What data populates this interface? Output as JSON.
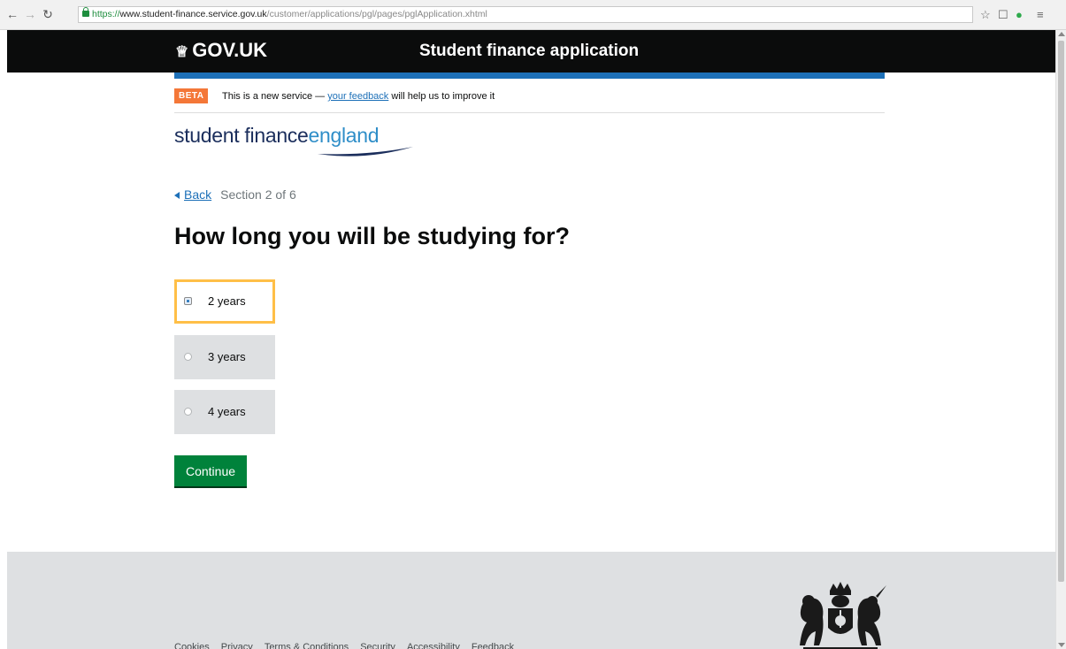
{
  "browser": {
    "url_https": "https://",
    "url_host": "www.student-finance.service.gov.uk",
    "url_path": "/customer/applications/pgl/pages/pglApplication.xhtml"
  },
  "header": {
    "logo_text": "GOV.UK",
    "service_name": "Student finance application"
  },
  "beta": {
    "tag": "BETA",
    "text_before": "This is a new service — ",
    "link_text": "your feedback",
    "text_after": " will help us to improve it"
  },
  "sfe_logo": {
    "part1": "student finance",
    "part2": "england"
  },
  "navigation": {
    "back_label": "Back",
    "section_text": "Section 2 of 6"
  },
  "question": {
    "title": "How long you will be studying for?",
    "options": [
      {
        "label": "2 years",
        "selected": true
      },
      {
        "label": "3 years",
        "selected": false
      },
      {
        "label": "4 years",
        "selected": false
      }
    ]
  },
  "actions": {
    "continue_label": "Continue"
  },
  "footer": {
    "links": [
      "Cookies",
      "Privacy",
      "Terms & Conditions",
      "Security",
      "Accessibility",
      "Feedback"
    ]
  },
  "colors": {
    "header_bg": "#0b0c0c",
    "blue_bar": "#1d70b8",
    "beta_tag": "#f47738",
    "link": "#1d70b8",
    "continue_button": "#00823b",
    "focus_border": "#ffbf47",
    "radio_bg": "#dee0e2",
    "footer_bg": "#dee0e2"
  },
  "icons": {
    "crown": "crown-icon",
    "back": "triangle-left-icon",
    "star": "star-icon",
    "crest": "royal-coat-of-arms-icon"
  }
}
